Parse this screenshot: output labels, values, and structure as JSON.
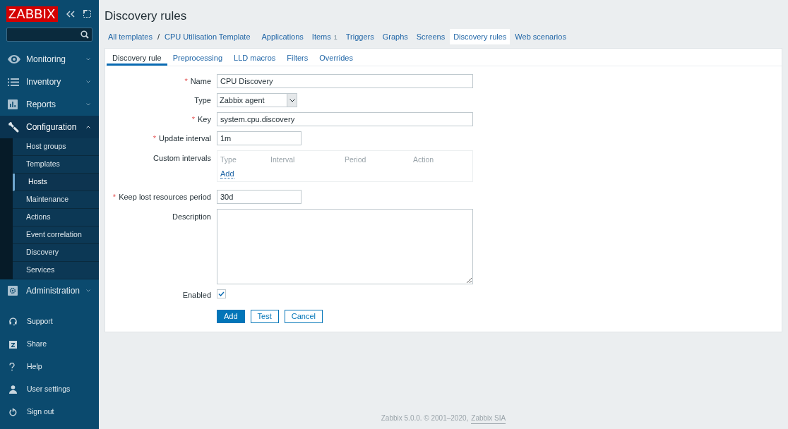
{
  "sidebar": {
    "logo": "ZABBIX",
    "menu": [
      {
        "label": "Monitoring",
        "expanded": false
      },
      {
        "label": "Inventory",
        "expanded": false
      },
      {
        "label": "Reports",
        "expanded": false
      },
      {
        "label": "Configuration",
        "expanded": true,
        "children": [
          {
            "label": "Host groups",
            "selected": false
          },
          {
            "label": "Templates",
            "selected": false
          },
          {
            "label": "Hosts",
            "selected": true
          },
          {
            "label": "Maintenance",
            "selected": false
          },
          {
            "label": "Actions",
            "selected": false
          },
          {
            "label": "Event correlation",
            "selected": false
          },
          {
            "label": "Discovery",
            "selected": false
          },
          {
            "label": "Services",
            "selected": false
          }
        ]
      },
      {
        "label": "Administration",
        "expanded": false
      }
    ],
    "links": [
      {
        "label": "Support"
      },
      {
        "label": "Share"
      },
      {
        "label": "Help"
      },
      {
        "label": "User settings"
      },
      {
        "label": "Sign out"
      }
    ]
  },
  "title": "Discovery rules",
  "breadcrumb": {
    "root": "All templates",
    "separator": "/",
    "template": "CPU Utilisation Template"
  },
  "nav_tabs": [
    {
      "label": "Applications",
      "selected": false
    },
    {
      "label": "Items",
      "count": "1",
      "selected": false
    },
    {
      "label": "Triggers",
      "selected": false
    },
    {
      "label": "Graphs",
      "selected": false
    },
    {
      "label": "Screens",
      "selected": false
    },
    {
      "label": "Discovery rules",
      "selected": true
    },
    {
      "label": "Web scenarios",
      "selected": false
    }
  ],
  "form_tabs": [
    {
      "label": "Discovery rule",
      "selected": true
    },
    {
      "label": "Preprocessing",
      "selected": false
    },
    {
      "label": "LLD macros",
      "selected": false
    },
    {
      "label": "Filters",
      "selected": false
    },
    {
      "label": "Overrides",
      "selected": false
    }
  ],
  "fields": [
    {
      "kind": "text",
      "required_mark": "*",
      "label": "Name",
      "value": "CPU Discovery"
    },
    {
      "kind": "select",
      "label": "Type",
      "value": "Zabbix agent"
    },
    {
      "kind": "text",
      "required_mark": "*",
      "label": "Key",
      "value": "system.cpu.discovery"
    },
    {
      "kind": "short",
      "required_mark": "*",
      "label": "Update interval",
      "value": "1m"
    },
    {
      "kind": "intervals",
      "label": "Custom intervals",
      "columns": [
        "Type",
        "Interval",
        "Period",
        "Action"
      ],
      "add": "Add"
    },
    {
      "kind": "short",
      "required_mark": "*",
      "label": "Keep lost resources period",
      "value": "30d"
    },
    {
      "kind": "textarea",
      "label": "Description"
    },
    {
      "kind": "checkbox",
      "label": "Enabled",
      "checked": true
    }
  ],
  "buttons": [
    {
      "label": "Add",
      "kind": "primary"
    },
    {
      "label": "Test",
      "kind": "secondary"
    },
    {
      "label": "Cancel",
      "kind": "secondary"
    }
  ],
  "footer": {
    "text": "Zabbix 5.0.0. © 2001–2020,",
    "link": "Zabbix SIA"
  }
}
